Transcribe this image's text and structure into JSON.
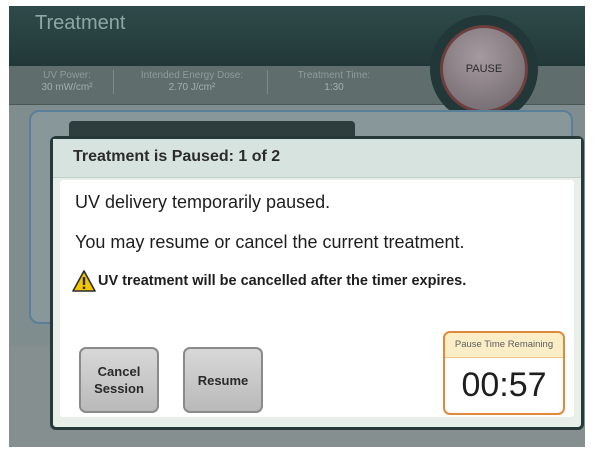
{
  "header": {
    "title": "Treatment",
    "pause_label": "PAUSE"
  },
  "params": [
    {
      "label": "UV Power:",
      "value": "30 mW/cm²"
    },
    {
      "label": "Intended Energy Dose:",
      "value": "2.70 J/cm²"
    },
    {
      "label": "Treatment Time:",
      "value": "1:30"
    }
  ],
  "dialog": {
    "title": "Treatment is Paused: 1 of 2",
    "message1": "UV delivery temporarily paused.",
    "message2": "You may resume or cancel the current treatment.",
    "warning": "UV treatment will be cancelled after the timer expires.",
    "cancel_line1": "Cancel",
    "cancel_line2": "Session",
    "resume_label": "Resume",
    "timer_label": "Pause Time Remaining",
    "timer_value": "00:57"
  },
  "icons": {
    "warning": "warning-triangle-icon"
  },
  "colors": {
    "accent_orange": "#e0893a",
    "warning_yellow": "#f2c500",
    "header_bg": "#223838"
  }
}
